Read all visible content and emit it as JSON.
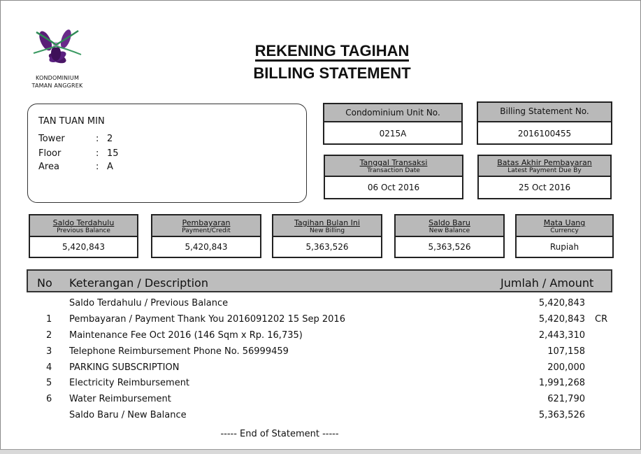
{
  "logo": {
    "line1": "KONDOMINIUM",
    "line2": "TAMAN ANGGREK"
  },
  "title": {
    "line1": "REKENING TAGIHAN",
    "line2": "BILLING STATEMENT"
  },
  "customer": {
    "name": "TAN TUAN MIN",
    "tower_label": "Tower",
    "tower": "2",
    "floor_label": "Floor",
    "floor": "15",
    "area_label": "Area",
    "area": "A",
    "colon": ":"
  },
  "unit": {
    "label": "Condominium Unit No.",
    "value": "0215A"
  },
  "statement_no": {
    "label": "Billing Statement No.",
    "value": "2016100455"
  },
  "transaction_date": {
    "label_id": "Tanggal Transaksi",
    "label_en": "Transaction Date",
    "value": "06 Oct 2016"
  },
  "due_date": {
    "label_id": "Batas Akhir Pembayaran",
    "label_en": "Latest Payment Due By",
    "value": "25 Oct 2016"
  },
  "summary": {
    "previous": {
      "label_id": "Saldo Terdahulu",
      "label_en": "Previous Balance",
      "value": "5,420,843"
    },
    "payment": {
      "label_id": "Pembayaran",
      "label_en": "Payment/Credit",
      "value": "5,420,843"
    },
    "billing": {
      "label_id": "Tagihan Bulan Ini",
      "label_en": "New Billing",
      "value": "5,363,526"
    },
    "new_balance": {
      "label_id": "Saldo Baru",
      "label_en": "New Balance",
      "value": "5,363,526"
    },
    "currency": {
      "label_id": "Mata Uang",
      "label_en": "Currency",
      "value": "Rupiah"
    }
  },
  "table": {
    "col_no": "No",
    "col_desc": "Keterangan / Description",
    "col_amount": "Jumlah / Amount",
    "rows": [
      {
        "no": "",
        "desc": "Saldo Terdahulu / Previous Balance",
        "amount": "5,420,843",
        "cr": ""
      },
      {
        "no": "1",
        "desc": "Pembayaran / Payment Thank You 2016091202 15 Sep 2016",
        "amount": "5,420,843",
        "cr": "CR"
      },
      {
        "no": "2",
        "desc": "Maintenance Fee Oct 2016 (146 Sqm x Rp. 16,735)",
        "amount": "2,443,310",
        "cr": ""
      },
      {
        "no": "3",
        "desc": "Telephone Reimbursement Phone No. 56999459",
        "amount": "107,158",
        "cr": ""
      },
      {
        "no": "4",
        "desc": "PARKING SUBSCRIPTION",
        "amount": "200,000",
        "cr": ""
      },
      {
        "no": "5",
        "desc": "Electricity Reimbursement",
        "amount": "1,991,268",
        "cr": ""
      },
      {
        "no": "6",
        "desc": "Water Reimbursement",
        "amount": "621,790",
        "cr": ""
      },
      {
        "no": "",
        "desc": "Saldo Baru / New Balance",
        "amount": "5,363,526",
        "cr": ""
      }
    ],
    "end_text": "----- End of Statement -----"
  }
}
